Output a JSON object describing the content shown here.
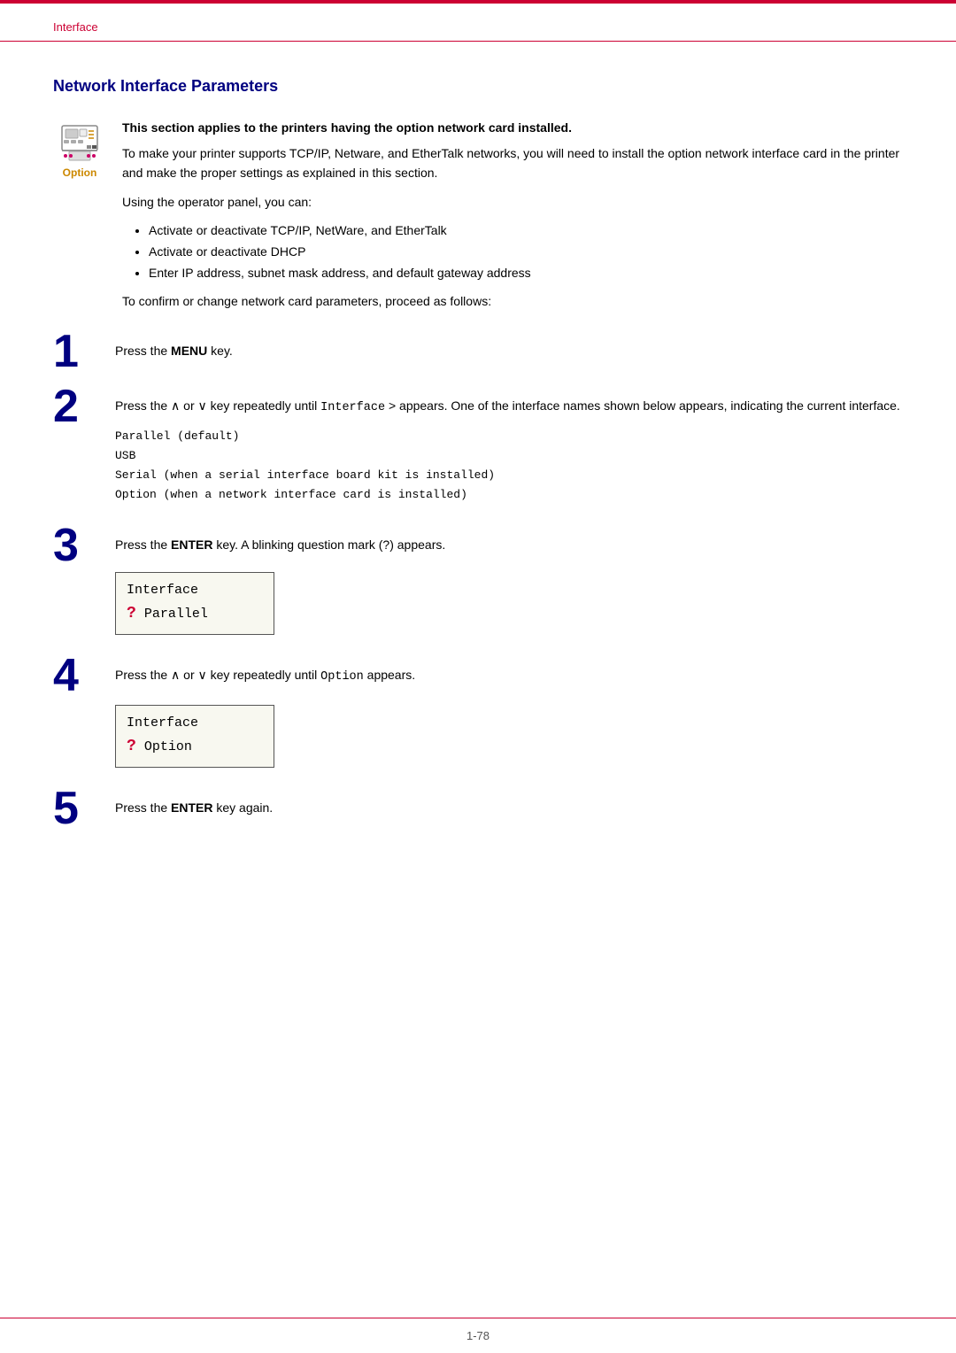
{
  "page": {
    "top_border_color": "#cc0033",
    "breadcrumb": "Interface",
    "section_title": "Network Interface Parameters",
    "footer_page": "1-78"
  },
  "intro": {
    "option_label": "Option",
    "bold_text": "This section applies to the printers having the option network card installed.",
    "para1": "To make your printer supports TCP/IP, Netware, and EtherTalk networks, you will need to install the option network interface card in the printer and make the proper settings as explained in this section.",
    "para2": "Using the operator panel, you can:"
  },
  "bullets": [
    "Activate or deactivate TCP/IP, NetWare, and EtherTalk",
    "Activate or deactivate DHCP",
    "Enter IP address, subnet mask address, and default gateway address"
  ],
  "before_steps": "To confirm or change network card parameters, proceed as follows:",
  "steps": [
    {
      "number": "1",
      "text": "Press the ",
      "bold": "MENU",
      "text2": " key.",
      "has_codelist": false,
      "has_display": false
    },
    {
      "number": "2",
      "text_pre": "Press the ∧ or ∨ key repeatedly until ",
      "code_inline": "Interface",
      "text_mid": " > appears. One of the interface names shown below appears, indicating the current interface.",
      "has_codelist": true,
      "has_display": false,
      "codelist": [
        {
          "code": "Parallel",
          "note": "(default)"
        },
        {
          "code": "USB",
          "note": ""
        },
        {
          "code": "Serial",
          "note": "(when a serial interface board kit is installed)"
        },
        {
          "code": "Option",
          "note": "(when a network interface card is installed)"
        }
      ]
    },
    {
      "number": "3",
      "text": "Press the ",
      "bold": "ENTER",
      "text2": " key. A blinking question mark (?) appears.",
      "has_display": true,
      "display_lines": [
        "Interface",
        "? Parallel"
      ]
    },
    {
      "number": "4",
      "text_pre": "Press the ∧ or ∨ key repeatedly until ",
      "code_inline": "Option",
      "text_mid": " appears.",
      "has_display": true,
      "display_lines": [
        "Interface",
        "? Option"
      ]
    },
    {
      "number": "5",
      "text": "Press the ",
      "bold": "ENTER",
      "text2": " key again.",
      "has_display": false
    }
  ]
}
